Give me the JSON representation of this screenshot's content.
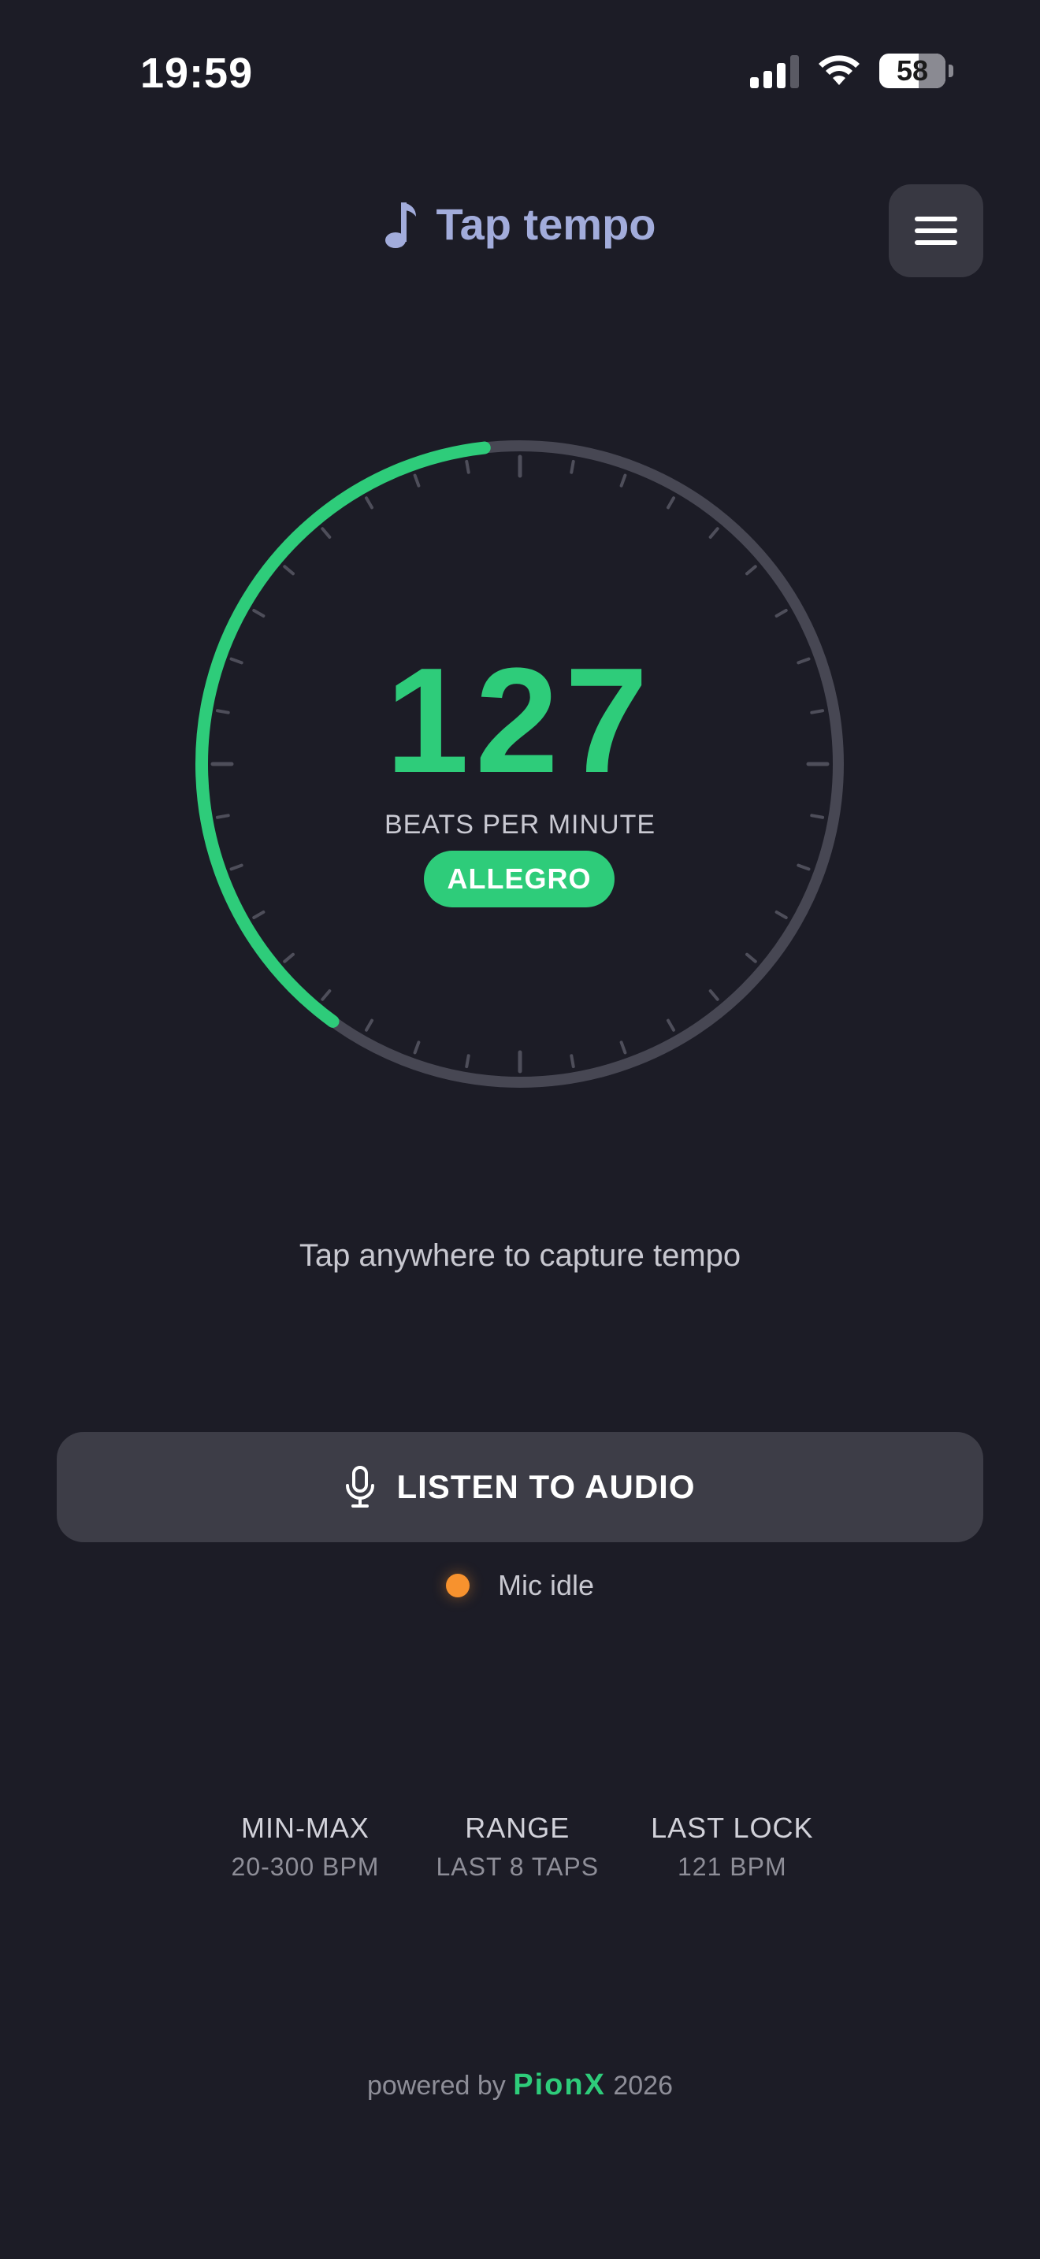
{
  "status_bar": {
    "time": "19:59",
    "battery": "58",
    "icons": [
      "signal-icon",
      "wifi-icon",
      "battery-icon"
    ]
  },
  "header": {
    "title": "Tap tempo",
    "icon": "music-note-icon",
    "menu_icon": "hamburger-menu-icon"
  },
  "dial": {
    "bpm": "127",
    "label": "BEATS PER MINUTE",
    "tempo_name": "ALLEGRO",
    "range_min": 20,
    "range_max": 300,
    "arc_color": "#2ecc7a"
  },
  "hint": "Tap anywhere to capture tempo",
  "listen": {
    "label": "LISTEN TO AUDIO",
    "icon": "microphone-icon"
  },
  "mic": {
    "status": "Mic idle",
    "dot_color": "#f7922e"
  },
  "stats": [
    {
      "title": "MIN-MAX",
      "value": "20-300 BPM"
    },
    {
      "title": "RANGE",
      "value": "LAST 8 TAPS"
    },
    {
      "title": "LAST LOCK",
      "value": "121 BPM"
    }
  ],
  "footer": {
    "prefix": "powered by",
    "brand": "PionX",
    "year": "2026"
  },
  "colors": {
    "background": "#1c1c26",
    "accent": "#2ecc7a",
    "title": "#a2acdb"
  }
}
